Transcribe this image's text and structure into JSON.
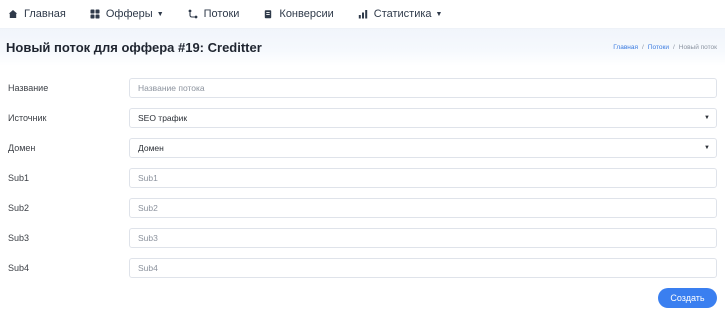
{
  "nav": {
    "items": [
      {
        "label": "Главная",
        "icon": "home-icon",
        "has_caret": false
      },
      {
        "label": "Офферы",
        "icon": "grid-icon",
        "has_caret": true
      },
      {
        "label": "Потоки",
        "icon": "flow-icon",
        "has_caret": false
      },
      {
        "label": "Конверсии",
        "icon": "clipboard-icon",
        "has_caret": false
      },
      {
        "label": "Статистика",
        "icon": "bar-chart-icon",
        "has_caret": true
      }
    ],
    "caret": "▼"
  },
  "header": {
    "title": "Новый поток для оффера #19: Creditter",
    "breadcrumb": {
      "home": "Главная",
      "flows": "Потоки",
      "current": "Новый поток",
      "separator": "/"
    }
  },
  "form": {
    "name_label": "Название",
    "name_placeholder": "Название потока",
    "source_label": "Источник",
    "source_value": "SEO трафик",
    "domain_label": "Домен",
    "domain_value": "Домен",
    "sub1_label": "Sub1",
    "sub1_placeholder": "Sub1",
    "sub2_label": "Sub2",
    "sub2_placeholder": "Sub2",
    "sub3_label": "Sub3",
    "sub3_placeholder": "Sub3",
    "sub4_label": "Sub4",
    "sub4_placeholder": "Sub4",
    "select_arrow": "▼",
    "submit_label": "Создать"
  },
  "colors": {
    "accent": "#3a7ff0",
    "link": "#3a7be0"
  }
}
